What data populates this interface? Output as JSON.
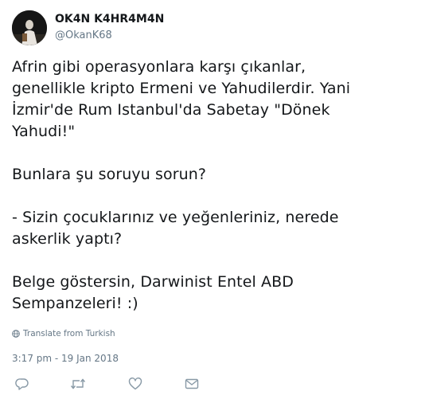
{
  "user": {
    "display_name": "OK4N K4HR4M4N",
    "handle": "@OkanK68",
    "avatar_icon": "avatar-photo"
  },
  "tweet": {
    "paragraphs": [
      "Afrin gibi operasyonlara karşı çıkanlar,\ngenellikle kripto Ermeni ve Yahudilerdir. Yani\nİzmir'de Rum Istanbul'da Sabetay \"Dönek\nYahudi!\"",
      "Bunlara şu soruyu sorun?",
      "- Sizin çocuklarınız ve yeğenleriniz, nerede\naskerlik yaptı?",
      "Belge göstersin, Darwinist Entel ABD\nSempanzeleri! :)"
    ],
    "translate_label": "Translate from Turkish",
    "timestamp": "3:17 pm - 19 Jan 2018"
  },
  "actions": {
    "icons": [
      "reply-icon",
      "retweet-icon",
      "like-icon",
      "message-icon"
    ]
  },
  "colors": {
    "text_primary": "#14171a",
    "text_secondary": "#657786",
    "icon_gray": "#8899a6"
  }
}
